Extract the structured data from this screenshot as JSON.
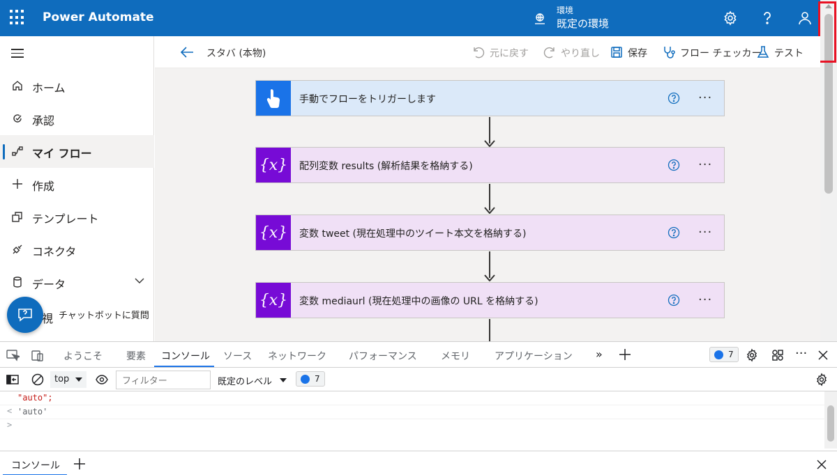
{
  "header": {
    "app_title": "Power Automate",
    "env_label": "環境",
    "env_name": "既定の環境"
  },
  "sidebar": {
    "items": [
      {
        "label": "ホーム",
        "icon": "home-icon"
      },
      {
        "label": "承認",
        "icon": "approvals-icon"
      },
      {
        "label": "マイ フロー",
        "icon": "my-flows-icon",
        "active": true
      },
      {
        "label": "作成",
        "icon": "plus-icon"
      },
      {
        "label": "テンプレート",
        "icon": "templates-icon"
      },
      {
        "label": "コネクタ",
        "icon": "connector-icon"
      },
      {
        "label": "データ",
        "icon": "database-icon"
      }
    ],
    "partial_item": "視",
    "chatbot_label": "チャットボットに質問"
  },
  "command_bar": {
    "flow_name": "スタバ (本物)",
    "undo": "元に戻す",
    "redo": "やり直し",
    "save": "保存",
    "flow_checker": "フロー チェッカー",
    "test": "テスト"
  },
  "flow": {
    "steps": [
      {
        "type": "trigger",
        "title": "手動でフローをトリガーします"
      },
      {
        "type": "variable",
        "icon_text": "{x}",
        "title": "配列変数 results (解析結果を格納する)"
      },
      {
        "type": "variable",
        "icon_text": "{x}",
        "title": "変数 tweet (現在処理中のツイート本文を格納する)"
      },
      {
        "type": "variable",
        "icon_text": "{x}",
        "title": "変数 mediaurl (現在処理中の画像の URL を格納する)"
      }
    ],
    "more_label": "···"
  },
  "devtools": {
    "tabs": [
      "ようこそ",
      "要素",
      "コンソール",
      "ソース",
      "ネットワーク",
      "パフォーマンス",
      "メモリ",
      "アプリケーション"
    ],
    "active_tab": "コンソール",
    "more_tabs": "»",
    "issues_count": "7",
    "context": "top",
    "filter_placeholder": "フィルター",
    "level": "既定のレベル",
    "toolbar_count": "7",
    "console_lines": [
      {
        "prefix": "",
        "text": "\"auto\";"
      },
      {
        "prefix": "<",
        "text": "'auto'"
      },
      {
        "prefix": ">",
        "text": ""
      }
    ],
    "drawer_tab": "コンソール"
  },
  "colors": {
    "header_bg": "#0f6cbd",
    "trigger_bg": "#dbe9f9",
    "trigger_icon_bg": "#1a73e8",
    "variable_bg": "#f0e0f6",
    "variable_icon_bg": "#770bd6",
    "highlight": "#e81123"
  }
}
